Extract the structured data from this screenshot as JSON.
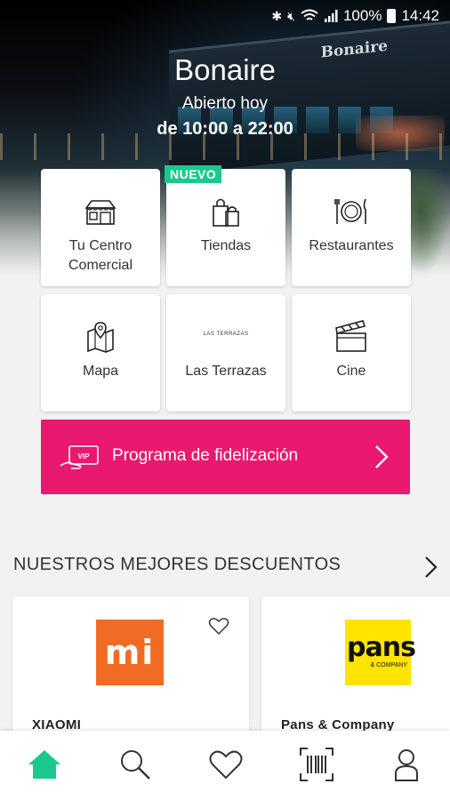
{
  "status_bar": {
    "battery": "100%",
    "time": "14:42"
  },
  "header": {
    "title": "Bonaire",
    "open_label": "Abierto hoy",
    "hours": "de 10:00 a 22:00",
    "building_sign": "Bonaire"
  },
  "tiles": [
    {
      "label": "Tu Centro Comercial",
      "icon": "shops-icon"
    },
    {
      "label": "Tiendas",
      "icon": "shopping-bags-icon",
      "badge": "NUEVO"
    },
    {
      "label": "Restaurantes",
      "icon": "plate-cutlery-icon"
    },
    {
      "label": "Mapa",
      "icon": "map-pin-icon"
    },
    {
      "label": "Las Terrazas",
      "icon": "las-terrazas-logo",
      "logo_text": "LAS TERRAZAS"
    },
    {
      "label": "Cine",
      "icon": "clapperboard-icon"
    }
  ],
  "loyalty": {
    "label": "Programa de fidelización",
    "card_text": "VIP"
  },
  "discounts": {
    "title": "NUESTROS MEJORES DESCUENTOS",
    "cards": [
      {
        "name": "XIAOMI",
        "logo_text": "mi"
      },
      {
        "name": "Pans & Company",
        "logo_text": "pans",
        "logo_sub": "& COMPANY"
      }
    ]
  },
  "bottom_nav": [
    "home-icon",
    "search-icon",
    "heart-icon",
    "barcode-scan-icon",
    "user-icon"
  ],
  "colors": {
    "accent_pink": "#e8196f",
    "accent_green": "#1bc98e",
    "xiaomi_orange": "#f26b24",
    "pans_yellow": "#fee400"
  }
}
